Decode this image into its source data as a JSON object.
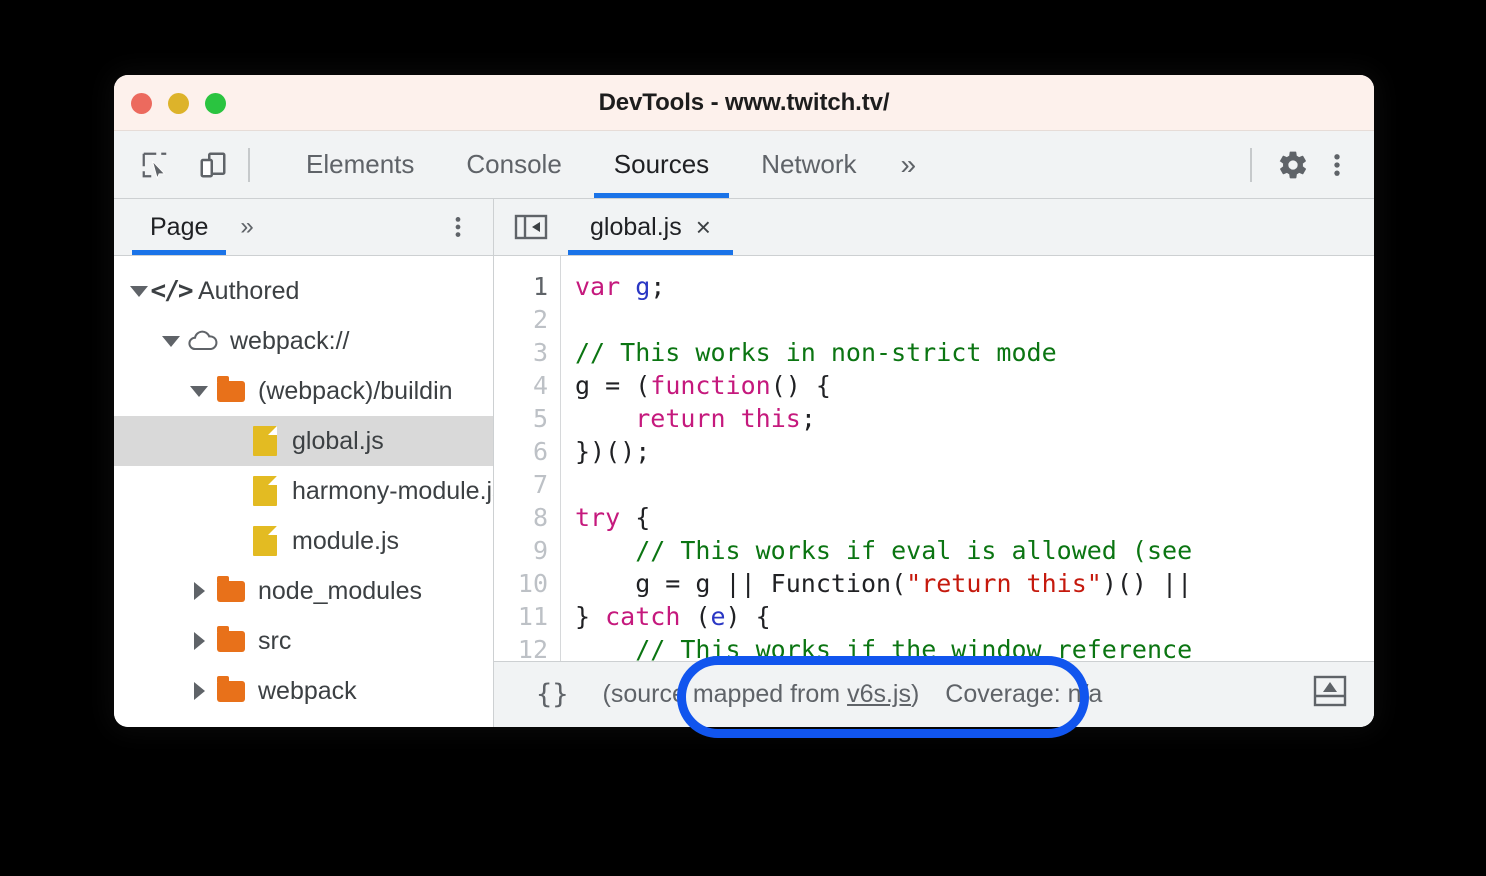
{
  "window": {
    "title": "DevTools - www.twitch.tv/",
    "traffic_lights": [
      {
        "name": "close",
        "color": "#ec6a5e"
      },
      {
        "name": "minimize",
        "color": "#ddb32a"
      },
      {
        "name": "maximize",
        "color": "#2ac440"
      }
    ]
  },
  "toolbar": {
    "inspect_icon": "inspect-element-icon",
    "device_icon": "device-toolbar-icon",
    "tabs": [
      {
        "label": "Elements",
        "active": false
      },
      {
        "label": "Console",
        "active": false
      },
      {
        "label": "Sources",
        "active": true
      },
      {
        "label": "Network",
        "active": false
      }
    ],
    "more_tabs": "»",
    "settings_icon": "gear-icon",
    "menu_icon": "kebab-menu-icon",
    "active_tab_color": "#1a73e8"
  },
  "navigator": {
    "tabs": [
      {
        "label": "Page",
        "active": true
      }
    ],
    "more_chevrons": "»",
    "kebab": "kebab-menu-icon",
    "tree": [
      {
        "label": "Authored",
        "icon": "code-icon",
        "indent": 0,
        "twisty": "down",
        "selected": false
      },
      {
        "label": "webpack://",
        "icon": "cloud-icon",
        "indent": 1,
        "twisty": "down",
        "selected": false
      },
      {
        "label": "(webpack)/buildin",
        "icon": "folder-icon",
        "indent": 2,
        "twisty": "down",
        "selected": false
      },
      {
        "label": "global.js",
        "icon": "file-icon",
        "indent": 3,
        "twisty": "none",
        "selected": true
      },
      {
        "label": "harmony-module.js",
        "icon": "file-icon",
        "indent": 3,
        "twisty": "none",
        "selected": false
      },
      {
        "label": "module.js",
        "icon": "file-icon",
        "indent": 3,
        "twisty": "none",
        "selected": false
      },
      {
        "label": "node_modules",
        "icon": "folder-icon",
        "indent": 2,
        "twisty": "right",
        "selected": false
      },
      {
        "label": "src",
        "icon": "folder-icon",
        "indent": 2,
        "twisty": "right",
        "selected": false
      },
      {
        "label": "webpack",
        "icon": "folder-icon",
        "indent": 2,
        "twisty": "right",
        "selected": false
      }
    ]
  },
  "editor": {
    "panel_toggle_icon": "show-navigator-icon",
    "tabs": [
      {
        "label": "global.js",
        "active": true,
        "close": "×"
      }
    ],
    "line_numbers": [
      "1",
      "2",
      "3",
      "4",
      "5",
      "6",
      "7",
      "8",
      "9",
      "10",
      "11",
      "12"
    ],
    "code_lines": [
      "var g;",
      "",
      "// This works in non-strict mode",
      "g = (function() {",
      "    return this;",
      "})();",
      "",
      "try {",
      "    // This works if eval is allowed (see",
      "    g = g || Function(\"return this\")() ||",
      "} catch (e) {",
      "    // This works if the window reference"
    ]
  },
  "statusbar": {
    "pretty_print": "{}",
    "source_mapped_prefix": "(source mapped from ",
    "source_mapped_link": "v6s.js",
    "source_mapped_suffix": ")",
    "coverage": "Coverage: n/a",
    "drawer_icon": "show-drawer-icon"
  },
  "annotation": {
    "color": "#1155ee",
    "target": "(source mapped from v6s.js)"
  }
}
